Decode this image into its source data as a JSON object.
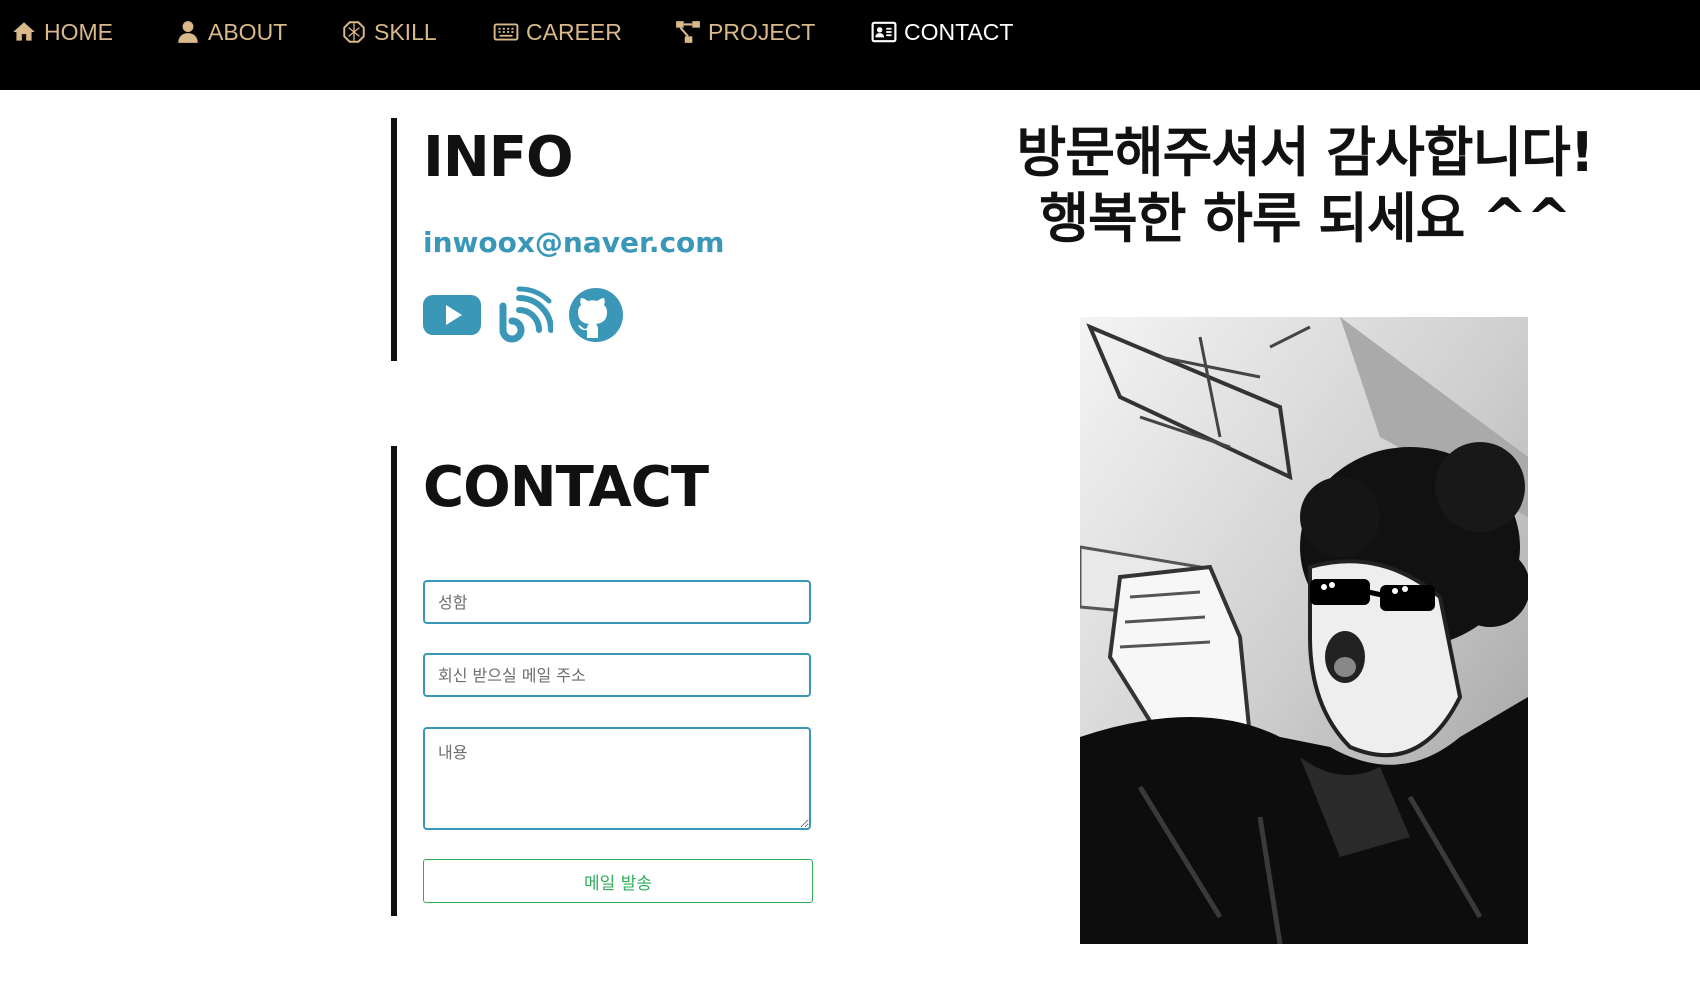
{
  "nav": {
    "items": [
      {
        "label": "HOME",
        "icon": "home-icon"
      },
      {
        "label": "ABOUT",
        "icon": "user-icon"
      },
      {
        "label": "SKILL",
        "icon": "skill-icon"
      },
      {
        "label": "CAREER",
        "icon": "keyboard-icon"
      },
      {
        "label": "PROJECT",
        "icon": "project-tree-icon"
      },
      {
        "label": "CONTACT",
        "icon": "contact-card-icon",
        "active": true
      }
    ]
  },
  "info": {
    "title": "INFO",
    "email": "inwoox@naver.com",
    "social": [
      "youtube-icon",
      "blog-icon",
      "github-icon"
    ]
  },
  "contact": {
    "title": "CONTACT",
    "name_placeholder": "성함",
    "email_placeholder": "회신 받으실 메일 주소",
    "message_placeholder": "내용",
    "send_label": "메일 발송"
  },
  "greeting": {
    "line1": "방문해주셔서 감사합니다!",
    "line2": "행복한 하루 되세요 ^^"
  },
  "colors": {
    "nav_bg": "#000000",
    "nav_text": "#d9b98a",
    "accent": "#3a97b8",
    "send": "#2fae5a"
  }
}
